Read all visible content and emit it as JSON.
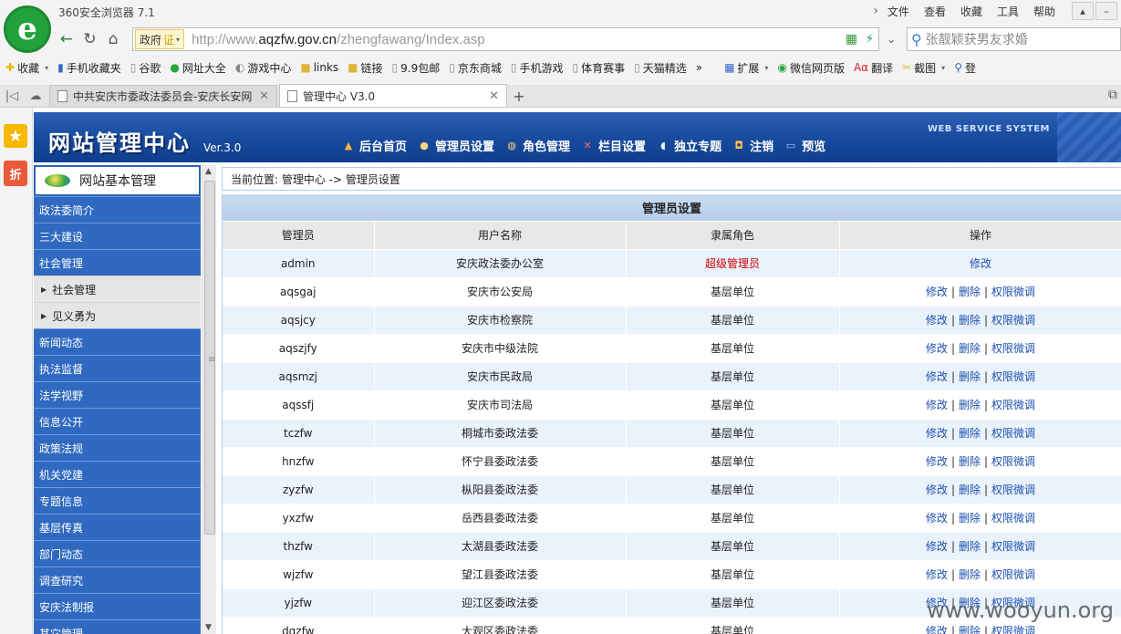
{
  "browser": {
    "app_title": "360安全浏览器 7.1",
    "menu": [
      "文件",
      "查看",
      "收藏",
      "工具",
      "帮助"
    ],
    "gov_badge": "政府",
    "cert_mark": "证",
    "url_prefix": "http://www.",
    "url_domain": "aqzfw.gov.cn",
    "url_path": "/zhengfawang/Index.asp",
    "search_placeholder": "张靓颖获男友求婚",
    "bookmarks": [
      {
        "label": "收藏",
        "icon": "star-add-icon"
      },
      {
        "label": "手机收藏夹",
        "icon": "phone-icon"
      },
      {
        "label": "谷歌",
        "icon": "page-icon"
      },
      {
        "label": "网址大全",
        "icon": "globe-icon"
      },
      {
        "label": "游戏中心",
        "icon": "gamepad-icon"
      },
      {
        "label": "links",
        "icon": "folder-icon"
      },
      {
        "label": "链接",
        "icon": "folder-icon"
      },
      {
        "label": "9.9包邮",
        "icon": "page-icon"
      },
      {
        "label": "京东商城",
        "icon": "page-icon"
      },
      {
        "label": "手机游戏",
        "icon": "page-icon"
      },
      {
        "label": "体育赛事",
        "icon": "page-icon"
      },
      {
        "label": "天猫精选",
        "icon": "page-icon"
      }
    ],
    "bookmark_tools": [
      {
        "label": "扩展",
        "icon": "extension-icon"
      },
      {
        "label": "微信网页版",
        "icon": "wechat-icon"
      },
      {
        "label": "翻译",
        "icon": "translate-icon"
      },
      {
        "label": "截图",
        "icon": "screenshot-icon"
      },
      {
        "label": "登",
        "icon": "login-icon"
      }
    ],
    "tabs": [
      {
        "title": "中共安庆市委政法委员会-安庆长安网",
        "active": false
      },
      {
        "title": "管理中心 V3.0",
        "active": true
      }
    ]
  },
  "admin": {
    "site_title": "网站管理中心",
    "version": "Ver.3.0",
    "web_service": "WEB SERVICE SYSTEM",
    "nav": [
      {
        "label": "后台首页",
        "icon": "home-icon"
      },
      {
        "label": "管理员设置",
        "icon": "admin-user-icon"
      },
      {
        "label": "角色管理",
        "icon": "roles-icon"
      },
      {
        "label": "栏目设置",
        "icon": "tools-icon"
      },
      {
        "label": "独立专题",
        "icon": "mouse-icon"
      },
      {
        "label": "注销",
        "icon": "lock-icon"
      },
      {
        "label": "预览",
        "icon": "monitor-icon"
      }
    ]
  },
  "sidebar": {
    "header": "网站基本管理",
    "items": [
      {
        "label": "政法委简介",
        "type": "main"
      },
      {
        "label": "三大建设",
        "type": "main"
      },
      {
        "label": "社会管理",
        "type": "main"
      },
      {
        "label": "社会管理",
        "type": "sub"
      },
      {
        "label": "见义勇为",
        "type": "sub"
      },
      {
        "label": "新闻动态",
        "type": "main"
      },
      {
        "label": "执法监督",
        "type": "main"
      },
      {
        "label": "法学视野",
        "type": "main"
      },
      {
        "label": "信息公开",
        "type": "main"
      },
      {
        "label": "政策法规",
        "type": "main"
      },
      {
        "label": "机关党建",
        "type": "main"
      },
      {
        "label": "专题信息",
        "type": "main"
      },
      {
        "label": "基层传真",
        "type": "main"
      },
      {
        "label": "部门动态",
        "type": "main"
      },
      {
        "label": "调查研究",
        "type": "main"
      },
      {
        "label": "安庆法制报",
        "type": "main"
      },
      {
        "label": "其它管理",
        "type": "main"
      }
    ]
  },
  "content": {
    "breadcrumb": "当前位置: 管理中心 -> 管理员设置",
    "panel_title": "管理员设置",
    "columns": [
      "管理员",
      "用户名称",
      "隶属角色",
      "操作"
    ],
    "op_labels": {
      "edit": "修改",
      "delete": "删除",
      "permission": "权限微调",
      "sep": "|"
    },
    "rows": [
      {
        "admin": "admin",
        "name": "安庆政法委办公室",
        "role": "超级管理员",
        "super": true
      },
      {
        "admin": "aqsgaj",
        "name": "安庆市公安局",
        "role": "基层单位",
        "super": false
      },
      {
        "admin": "aqsjcy",
        "name": "安庆市检察院",
        "role": "基层单位",
        "super": false
      },
      {
        "admin": "aqszjfy",
        "name": "安庆市中级法院",
        "role": "基层单位",
        "super": false
      },
      {
        "admin": "aqsmzj",
        "name": "安庆市民政局",
        "role": "基层单位",
        "super": false
      },
      {
        "admin": "aqssfj",
        "name": "安庆市司法局",
        "role": "基层单位",
        "super": false
      },
      {
        "admin": "tczfw",
        "name": "桐城市委政法委",
        "role": "基层单位",
        "super": false
      },
      {
        "admin": "hnzfw",
        "name": "怀宁县委政法委",
        "role": "基层单位",
        "super": false
      },
      {
        "admin": "zyzfw",
        "name": "枞阳县委政法委",
        "role": "基层单位",
        "super": false
      },
      {
        "admin": "yxzfw",
        "name": "岳西县委政法委",
        "role": "基层单位",
        "super": false
      },
      {
        "admin": "thzfw",
        "name": "太湖县委政法委",
        "role": "基层单位",
        "super": false
      },
      {
        "admin": "wjzfw",
        "name": "望江县委政法委",
        "role": "基层单位",
        "super": false
      },
      {
        "admin": "yjzfw",
        "name": "迎江区委政法委",
        "role": "基层单位",
        "super": false
      },
      {
        "admin": "dgzfw",
        "name": "大观区委政法委",
        "role": "基层单位",
        "super": false
      }
    ]
  },
  "watermark": "www.wooyun.org"
}
